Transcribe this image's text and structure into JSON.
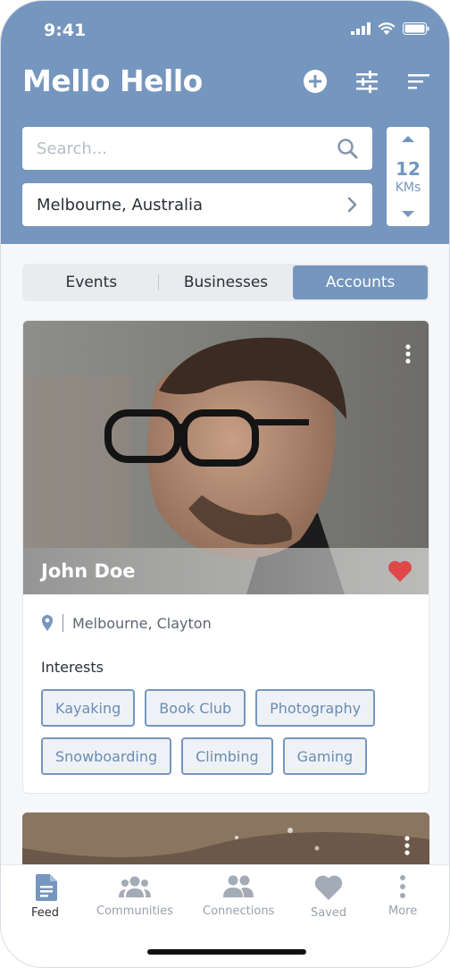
{
  "status": {
    "time": "9:41"
  },
  "header": {
    "logo": "Mello Hello"
  },
  "search": {
    "placeholder": "Search..."
  },
  "location": {
    "label": "Melbourne, Australia"
  },
  "radius": {
    "value": "12",
    "unit": "KMs"
  },
  "tabs": [
    {
      "label": "Events"
    },
    {
      "label": "Businesses"
    },
    {
      "label": "Accounts",
      "active": true
    }
  ],
  "card": {
    "name": "John Doe",
    "location": "Melbourne, Clayton",
    "interests_title": "Interests",
    "interests": [
      "Kayaking",
      "Book Club",
      "Photography",
      "Snowboarding",
      "Climbing",
      "Gaming"
    ]
  },
  "tabbar": [
    {
      "label": "Feed",
      "icon": "document-icon",
      "active": true
    },
    {
      "label": "Communities",
      "icon": "group-icon"
    },
    {
      "label": "Connections",
      "icon": "people-icon"
    },
    {
      "label": "Saved",
      "icon": "heart-icon"
    },
    {
      "label": "More",
      "icon": "more-icon"
    }
  ],
  "colors": {
    "accent": "#7596be",
    "heart": "#e04848"
  }
}
